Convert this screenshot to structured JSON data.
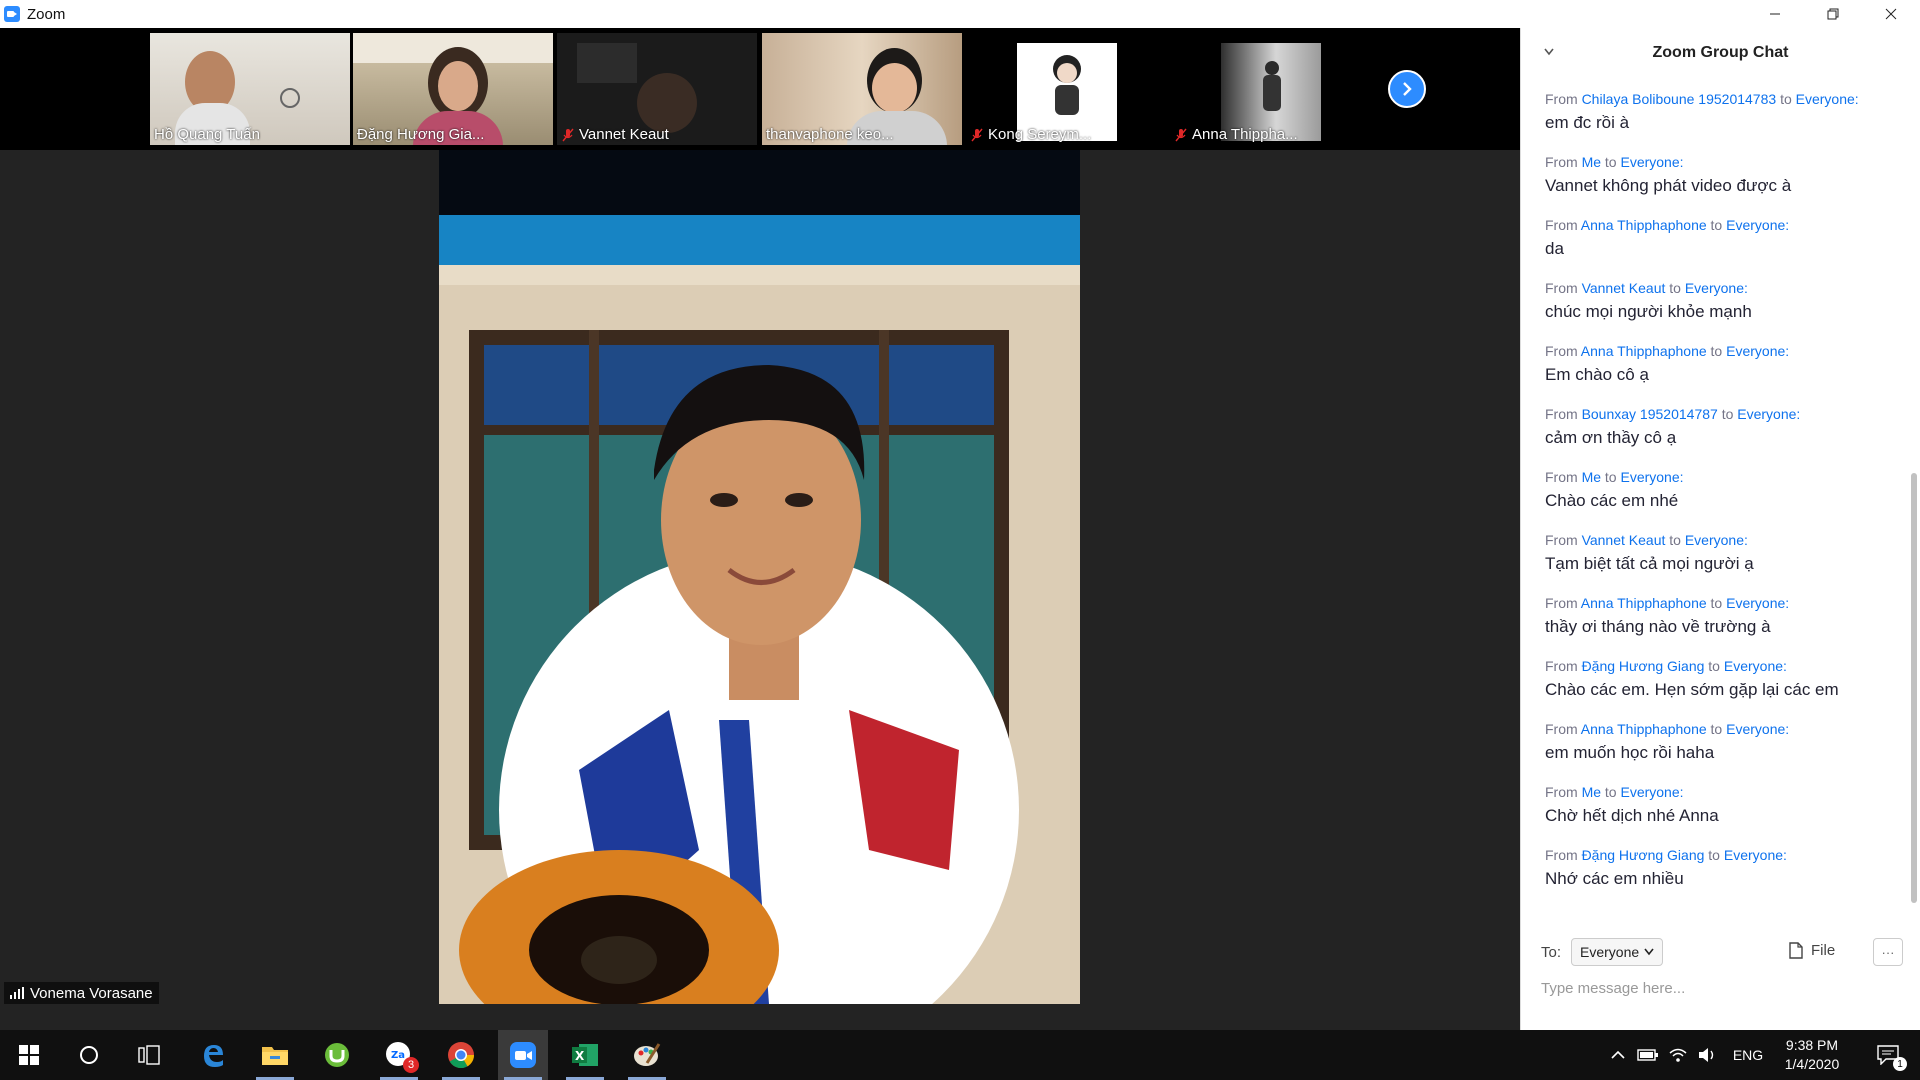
{
  "window": {
    "title": "Zoom"
  },
  "thumbnails": [
    {
      "name": "Hồ Quang Tuấn",
      "muted": false
    },
    {
      "name": "Đặng Hương Gia...",
      "muted": false
    },
    {
      "name": "Vannet Keaut",
      "muted": true
    },
    {
      "name": "thanvaphone keo...",
      "muted": false
    },
    {
      "name": "Kong Sereym...",
      "muted": true
    },
    {
      "name": "Anna Thippha...",
      "muted": true
    }
  ],
  "main_video": {
    "speaker_name": "Vonema Vorasane"
  },
  "chat": {
    "title": "Zoom Group Chat",
    "from_label": "From",
    "to_word": "to",
    "messages": [
      {
        "sender": "Chilaya Boliboune 1952014783",
        "recipient": "Everyone:",
        "text": "em đc rồi à"
      },
      {
        "sender": "Me",
        "recipient": "Everyone:",
        "text": "Vannet không phát video được à"
      },
      {
        "sender": "Anna Thipphaphone",
        "recipient": "Everyone:",
        "text": "da"
      },
      {
        "sender": "Vannet Keaut",
        "recipient": "Everyone:",
        "text": "chúc mọi người khỏe mạnh"
      },
      {
        "sender": "Anna Thipphaphone",
        "recipient": "Everyone:",
        "text": "Em chào cô ạ"
      },
      {
        "sender": "Bounxay 1952014787",
        "recipient": "Everyone:",
        "text": "cảm ơn thầy cô ạ"
      },
      {
        "sender": "Me",
        "recipient": "Everyone:",
        "text": "Chào các em nhé"
      },
      {
        "sender": "Vannet Keaut",
        "recipient": "Everyone:",
        "text": "Tạm biệt tất cả mọi người ạ"
      },
      {
        "sender": "Anna Thipphaphone",
        "recipient": "Everyone:",
        "text": "thầy ơi tháng nào về trường à"
      },
      {
        "sender": "Đặng Hương Giang",
        "recipient": "Everyone:",
        "text": "Chào các em. Hẹn sớm gặp lại các em"
      },
      {
        "sender": "Anna Thipphaphone",
        "recipient": "Everyone:",
        "text": "em muốn học rồi haha"
      },
      {
        "sender": "Me",
        "recipient": "Everyone:",
        "text": "Chờ hết dịch  nhé Anna"
      },
      {
        "sender": "Đặng Hương Giang",
        "recipient": "Everyone:",
        "text": "Nhớ các em nhiều"
      }
    ],
    "compose": {
      "to_label": "To:",
      "to_value": "Everyone",
      "file_label": "File",
      "more_label": "···",
      "placeholder": "Type message here..."
    }
  },
  "taskbar": {
    "language": "ENG",
    "time": "9:38 PM",
    "date": "1/4/2020",
    "notification_count": "1",
    "zalo_badge": "3",
    "items": [
      "windows-start",
      "cortana-search",
      "task-view",
      "edge",
      "file-explorer",
      "utorrent",
      "zalo",
      "chrome",
      "zoom",
      "excel",
      "paint"
    ]
  },
  "colors": {
    "zoom_blue": "#2D8CFF",
    "link_blue": "#0E72ED",
    "mute_red": "#E02828"
  }
}
